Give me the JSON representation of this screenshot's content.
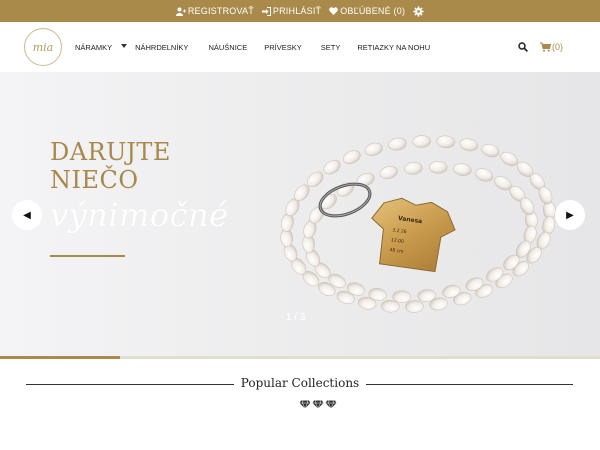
{
  "topbar": {
    "register_label": "REGISTROVAŤ",
    "login_label": "PRIHLÁSIŤ",
    "favorites_label": "OBĽÚBENÉ (0)"
  },
  "logo": {
    "text": "mia"
  },
  "menu": {
    "items": [
      {
        "label": "NÁRAMKY"
      },
      {
        "label": "NÁHRDELNÍKY"
      },
      {
        "label": "NÁUŠNICE"
      },
      {
        "label": "PRÍVESKY"
      },
      {
        "label": "SETY"
      },
      {
        "label": "RETIAZKY NA NOHU"
      }
    ]
  },
  "cart": {
    "count": "(0)"
  },
  "hero": {
    "line1": "DARUJTE",
    "line2": "NIEČO",
    "script": "výnimočné",
    "counter": "1 / 3",
    "progress": 0.2,
    "tag_lines": [
      "Vanesa",
      "3.2.26",
      "12:00",
      "48 cm"
    ]
  },
  "popular": {
    "title": "Popular Collections"
  },
  "colors": {
    "gold": "#a98a4a",
    "hero_text": "#a8894c"
  }
}
